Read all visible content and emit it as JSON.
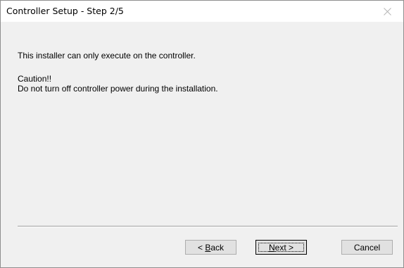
{
  "window": {
    "title": "Controller Setup - Step 2/5"
  },
  "message": {
    "line1": "This installer can only execute on the controller.",
    "caution_title": "Caution!!",
    "caution_text": "Do not turn off controller power during the installation."
  },
  "buttons": {
    "back": {
      "prefix": "< ",
      "mnemonic": "B",
      "rest": "ack"
    },
    "next": {
      "mnemonic": "N",
      "rest": "ext >"
    },
    "cancel": {
      "label": "Cancel"
    }
  },
  "icons": {
    "close": "close-icon"
  }
}
